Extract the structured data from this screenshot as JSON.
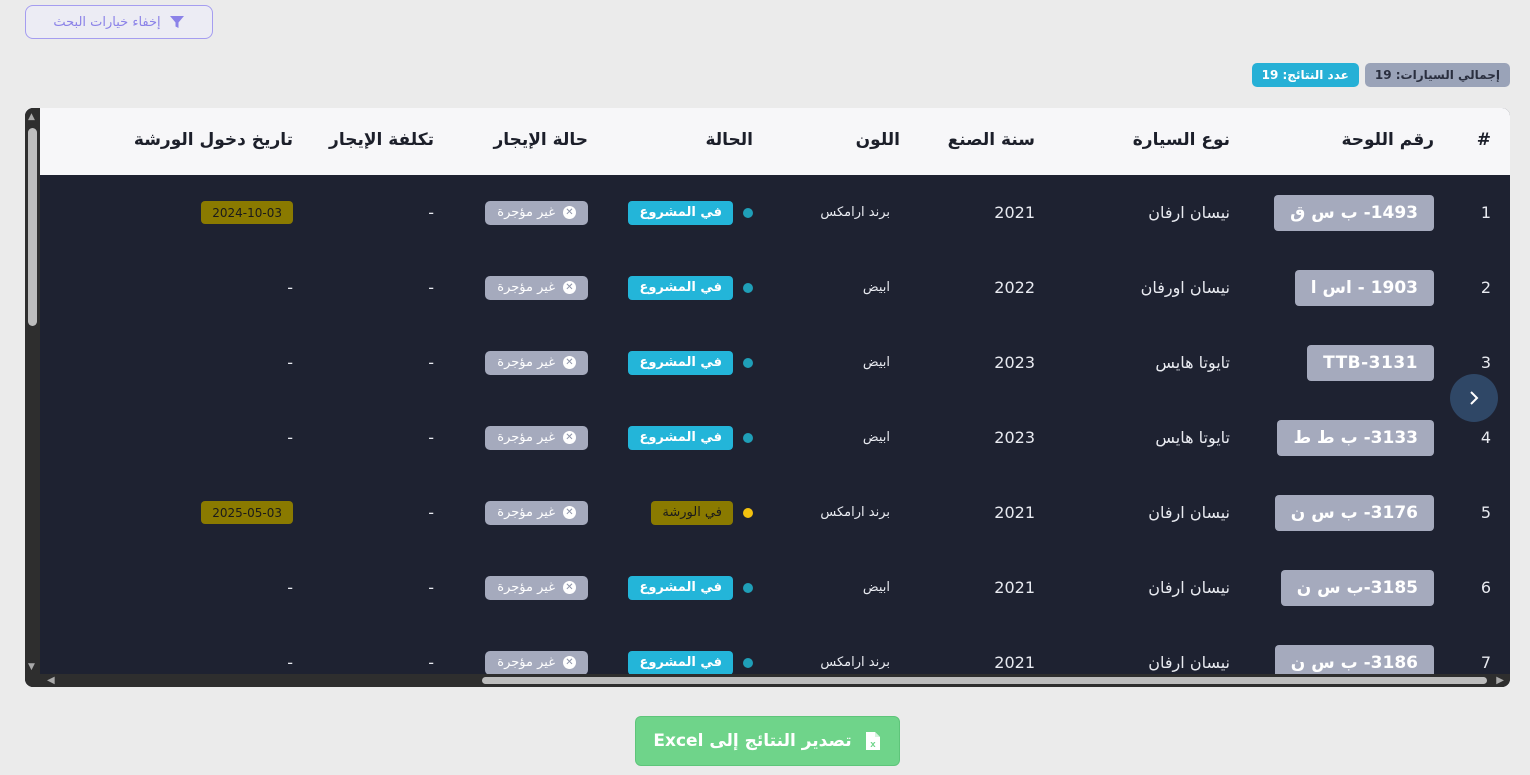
{
  "toolbar": {
    "hide_search_label": "إخفاء خيارات البحث"
  },
  "summary": {
    "total_cars": "إجمالي السيارات: 19",
    "results_count": "عدد النتائج: 19"
  },
  "columns": [
    "#",
    "رقم اللوحة",
    "نوع السيارة",
    "سنة الصنع",
    "اللون",
    "الحالة",
    "حالة الإيجار",
    "تكلفة الإيجار",
    "تاريخ دخول الورشة"
  ],
  "rows": [
    {
      "num": "1",
      "plate": "1493- ب س ق",
      "type": "نيسان ارفان",
      "year": "2021",
      "color": "برند ارامكس",
      "status": "في المشروع",
      "status_kind": "project",
      "rent": "غير مؤجرة",
      "cost": "-",
      "workshop_date": "2024-10-03"
    },
    {
      "num": "2",
      "plate": "1903 - اس ا",
      "type": "نيسان اورفان",
      "year": "2022",
      "color": "ابيض",
      "status": "في المشروع",
      "status_kind": "project",
      "rent": "غير مؤجرة",
      "cost": "-",
      "workshop_date": "-"
    },
    {
      "num": "3",
      "plate": "TTB-3131",
      "type": "تايوتا هايس",
      "year": "2023",
      "color": "ابيض",
      "status": "في المشروع",
      "status_kind": "project",
      "rent": "غير مؤجرة",
      "cost": "-",
      "workshop_date": "-"
    },
    {
      "num": "4",
      "plate": "3133- ب ط ط",
      "type": "تايوتا هايس",
      "year": "2023",
      "color": "ابيض",
      "status": "في المشروع",
      "status_kind": "project",
      "rent": "غير مؤجرة",
      "cost": "-",
      "workshop_date": "-"
    },
    {
      "num": "5",
      "plate": "3176- ب س ن",
      "type": "نيسان ارفان",
      "year": "2021",
      "color": "برند ارامكس",
      "status": "في الورشة",
      "status_kind": "shop",
      "rent": "غير مؤجرة",
      "cost": "-",
      "workshop_date": "2025-05-03"
    },
    {
      "num": "6",
      "plate": "3185-ب س ن",
      "type": "نيسان ارفان",
      "year": "2021",
      "color": "ابيض",
      "status": "في المشروع",
      "status_kind": "project",
      "rent": "غير مؤجرة",
      "cost": "-",
      "workshop_date": "-"
    },
    {
      "num": "7",
      "plate": "3186- ب س ن",
      "type": "نيسان ارفان",
      "year": "2021",
      "color": "برند ارامكس",
      "status": "في المشروع",
      "status_kind": "project",
      "rent": "غير مؤجرة",
      "cost": "-",
      "workshop_date": "-"
    }
  ],
  "status_colors": {
    "project": "#23b5d9",
    "project_dot": "#1f9fb8",
    "shop": "#8a7a00",
    "shop_dot": "#f2c10f"
  },
  "export": {
    "label": "تصدير النتائج إلى Excel"
  },
  "icons": {
    "filter": "filter-icon",
    "excel": "excel-file-icon",
    "next": "chevron-right-icon",
    "remove": "x-circle-icon"
  }
}
